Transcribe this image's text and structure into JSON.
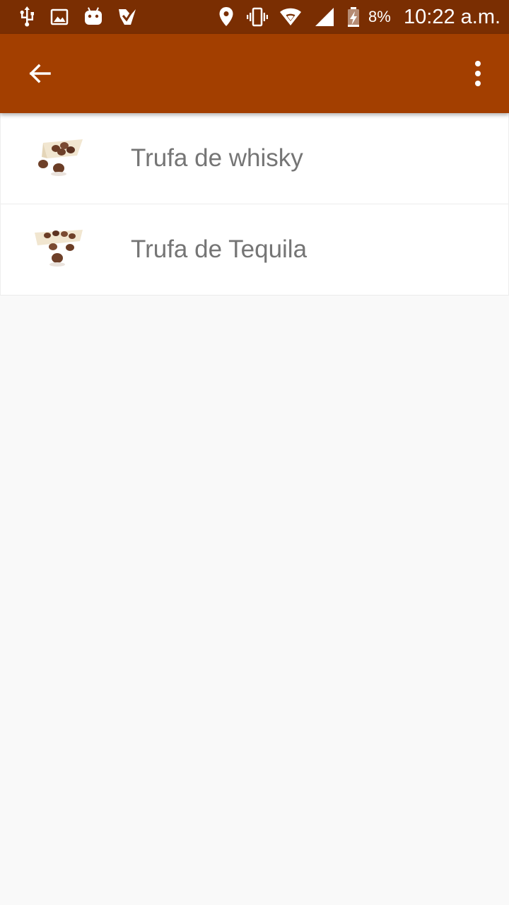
{
  "status_bar": {
    "battery_percent": "8%",
    "time": "10:22 a.m.",
    "icons": [
      "usb-icon",
      "image-icon",
      "android-icon",
      "checkmark-app-icon",
      "location-icon",
      "vibrate-icon",
      "wifi-icon",
      "signal-icon",
      "battery-charging-icon"
    ]
  },
  "app_bar": {
    "back_icon": "arrow-back-icon",
    "menu_icon": "more-vert-icon",
    "color": "#a33f00"
  },
  "colors": {
    "status_bar": "#7a2e02",
    "background": "#f9f9f9",
    "item_text": "#757575"
  },
  "list": {
    "items": [
      {
        "label": "Trufa de whisky",
        "thumbnail": "truffles-plate-image"
      },
      {
        "label": "Trufa de Tequila",
        "thumbnail": "truffles-plate-image"
      }
    ]
  }
}
